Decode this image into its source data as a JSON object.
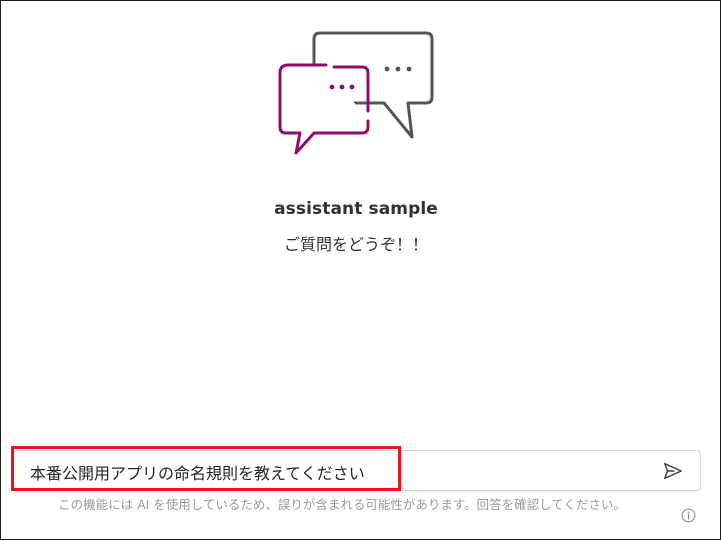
{
  "assistant": {
    "name": "assistant sample",
    "greeting": "ご質問をどうぞ！！"
  },
  "hero": {
    "icon": "chat-bubbles-icon",
    "colors": {
      "front_bubble": "#8b0f6b",
      "back_bubble": "#555555"
    }
  },
  "composer": {
    "value": "本番公開用アプリの命名規則を教えてください",
    "send_icon": "send-icon"
  },
  "footer": {
    "disclaimer": "この機能には AI を使用しているため、誤りが含まれる可能性があります。回答を確認してください。",
    "info_icon": "info-icon"
  },
  "annotation": {
    "highlight_color": "#e8131b"
  }
}
